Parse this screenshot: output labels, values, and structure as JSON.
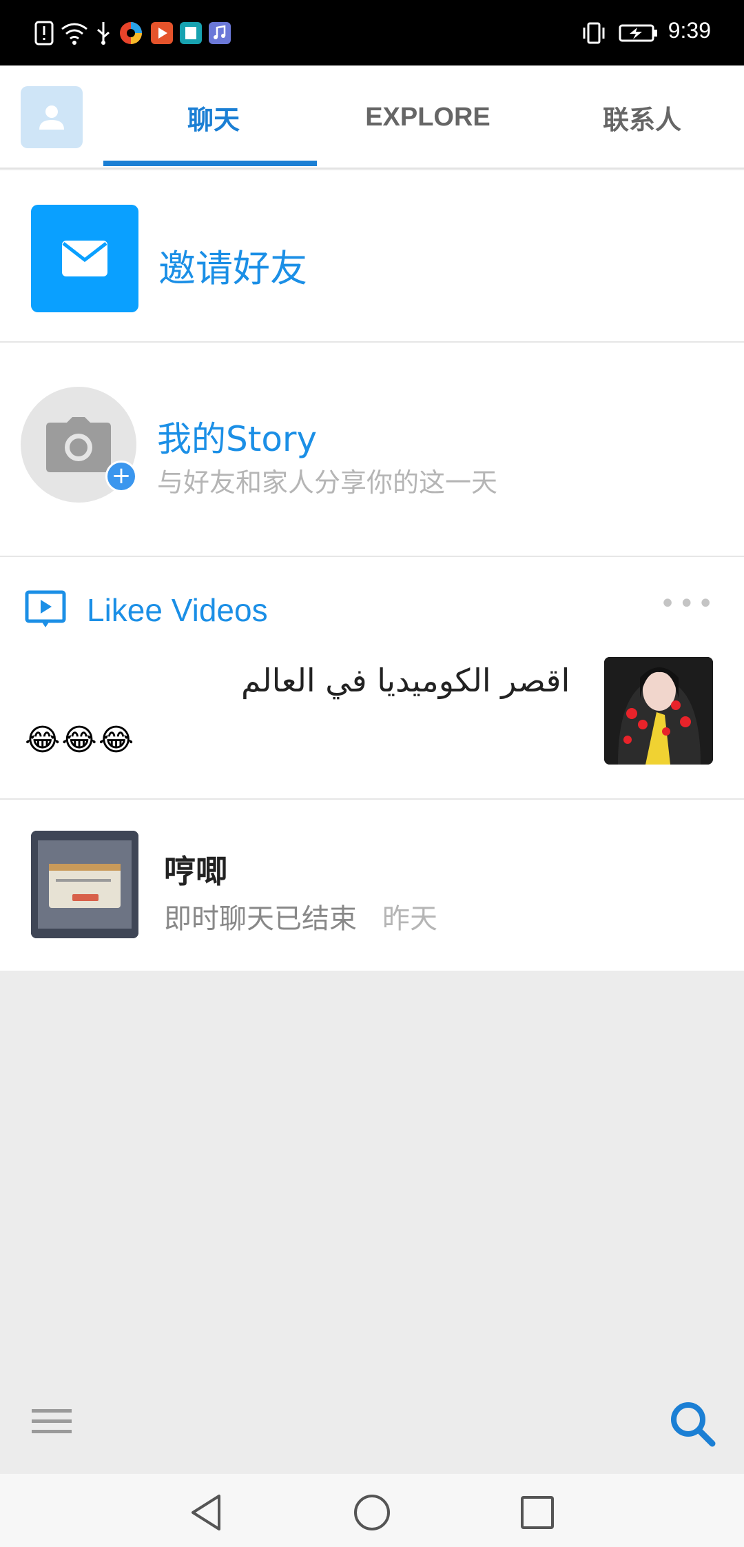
{
  "status_bar": {
    "time": "9:39",
    "icons": [
      "alert-icon",
      "wifi-icon",
      "usb-icon",
      "app-icon-browser",
      "app-icon-video",
      "app-icon-reader",
      "app-icon-music",
      "vibrate-icon",
      "battery-charging-icon"
    ]
  },
  "tabs": [
    {
      "label": "聊天",
      "active": true
    },
    {
      "label": "EXPLORE",
      "active": false
    },
    {
      "label": "联系人",
      "active": false
    }
  ],
  "invite": {
    "label": "邀请好友"
  },
  "story": {
    "title": "我的Story",
    "subtitle": "与好友和家人分享你的这一天"
  },
  "likee": {
    "title": "Likee Videos",
    "caption": "اقصر الكوميديا في العالم",
    "emoji": "😂😂😂"
  },
  "chat": {
    "name": "哼唧",
    "preview": "即时聊天已结束",
    "time": "昨天"
  },
  "colors": {
    "accent": "#1b7fd4",
    "invite_bg": "#0aa0ff",
    "link": "#1b8fe6"
  }
}
